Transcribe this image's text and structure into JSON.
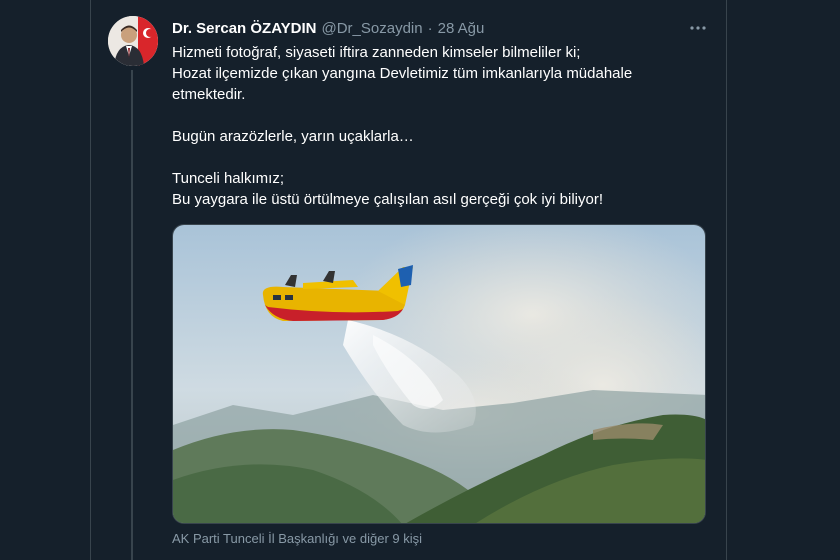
{
  "tweet": {
    "author_name": "Dr. Sercan ÖZAYDIN",
    "handle": "@Dr_Sozaydin",
    "separator": "·",
    "date": "28 Ağu",
    "more_glyph": "•••",
    "text_lines": [
      "Hizmeti fotoğraf, siyaseti iftira zanneden kimseler bilmeliler ki;",
      "Hozat ilçemizde çıkan yangına Devletimiz tüm imkanlarıyla müdahale",
      "etmektedir.",
      "",
      "Bugün arazözlerle, yarın uçaklarla…",
      "",
      "Tunceli halkımız;",
      "Bu yaygara ile üstü örtülmeye çalışılan asıl gerçeği çok iyi biliyor!"
    ],
    "tagged_users": "AK Parti Tunceli İl Başkanlığı ve diğer 9 kişi"
  },
  "icons": {
    "more": "more-horizontal-icon",
    "avatar": "profile-avatar"
  },
  "colors": {
    "background": "#15202b",
    "border": "#38444d",
    "primary_text": "#ffffff",
    "secondary_text": "#8899a6"
  }
}
